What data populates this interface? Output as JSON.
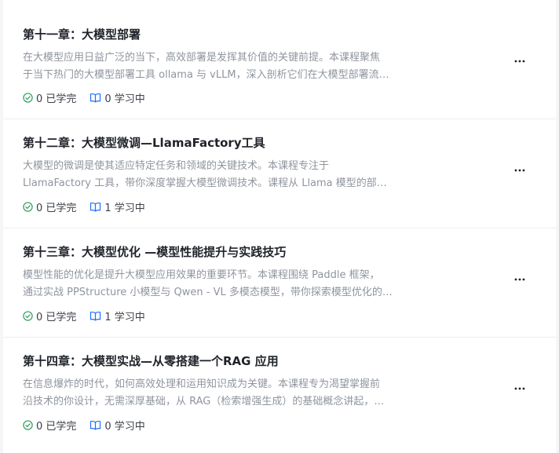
{
  "chapters": [
    {
      "title": "第十一章：大模型部署",
      "desc_line1": "在大模型应用日益广泛的当下，高效部署是发挥其价值的关键前提。本课程聚焦",
      "desc_line2": "于当下热门的大模型部署工具 ollama 与 vLLM，深入剖析它们在大模型部署流…",
      "completed": "0 已学完",
      "learning": "0 学习中"
    },
    {
      "title": "第十二章：大模型微调—LlamaFactory工具",
      "desc_line1": "大模型的微调是使其适应特定任务和领域的关键技术。本课程专注于",
      "desc_line2": "LlamaFactory 工具，带你深度掌握大模型微调技术。课程从 Llama 模型的部…",
      "completed": "0 已学完",
      "learning": "1 学习中"
    },
    {
      "title": "第十三章：大模型优化 —模型性能提升与实践技巧",
      "desc_line1": "模型性能的优化是提升大模型应用效果的重要环节。本课程围绕 Paddle 框架，",
      "desc_line2": "通过实战 PPStructure 小模型与 Qwen - VL 多模态模型，带你探索模型优化的…",
      "completed": "0 已学完",
      "learning": "1 学习中"
    },
    {
      "title": "第十四章：大模型实战—从零搭建一个RAG 应用",
      "desc_line1": "在信息爆炸的时代，如何高效处理和运用知识成为关键。本课程专为渴望掌握前",
      "desc_line2": "沿技术的你设计，无需深厚基础，从 RAG（检索增强生成）的基础概念讲起，…",
      "completed": "0 已学完",
      "learning": "0 学习中"
    }
  ],
  "icons": {
    "completed": "check-circle-icon",
    "learning": "open-book-icon",
    "more": "more-horizontal-icon"
  },
  "colors": {
    "accent": "#1e6fff",
    "success": "#2e9e5b",
    "title": "#1f2329",
    "desc": "#8f959e"
  }
}
